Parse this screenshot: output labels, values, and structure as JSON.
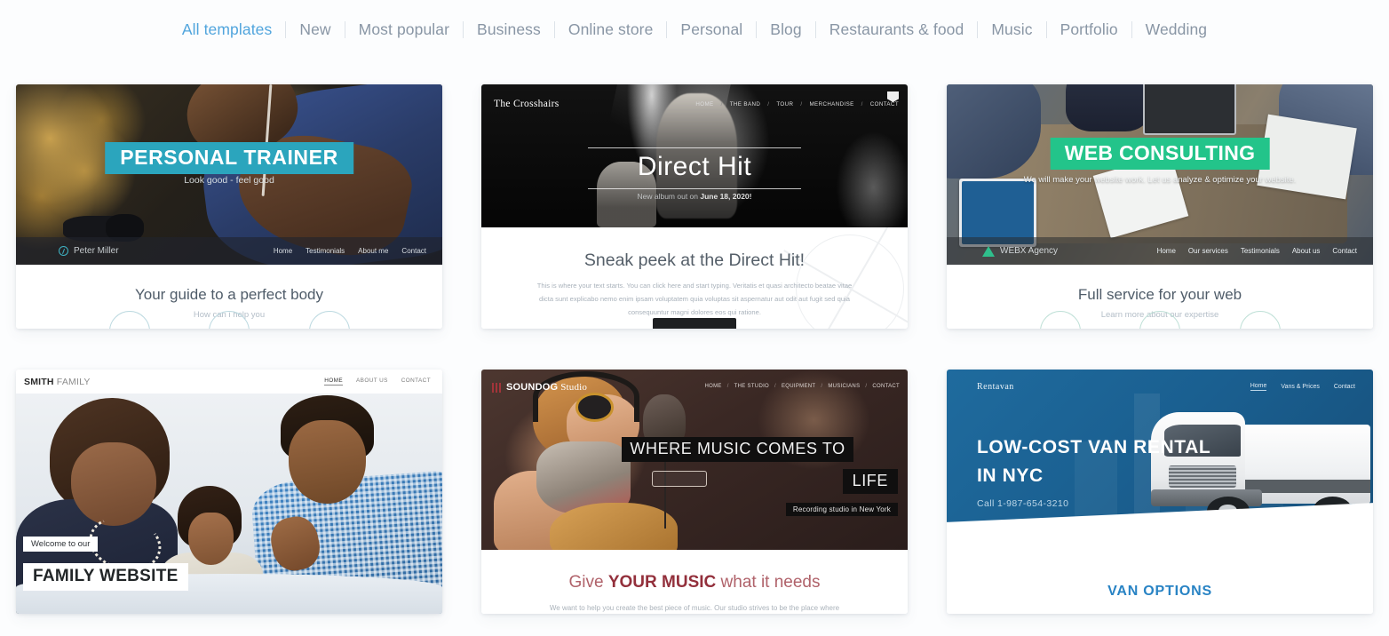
{
  "categories": [
    {
      "label": "All templates",
      "active": true
    },
    {
      "label": "New",
      "active": false
    },
    {
      "label": "Most popular",
      "active": false
    },
    {
      "label": "Business",
      "active": false
    },
    {
      "label": "Online store",
      "active": false
    },
    {
      "label": "Personal",
      "active": false
    },
    {
      "label": "Blog",
      "active": false
    },
    {
      "label": "Restaurants & food",
      "active": false
    },
    {
      "label": "Music",
      "active": false
    },
    {
      "label": "Portfolio",
      "active": false
    },
    {
      "label": "Wedding",
      "active": false
    }
  ],
  "colors": {
    "active_nav": "#51a5dd",
    "inactive_nav": "#8996a5",
    "page_bg": "#fcfdfe",
    "card_bg": "#ffffff",
    "trainer_accent": "#2ba5bd",
    "consulting_accent": "#23c48a",
    "music_accent": "#93303c",
    "van_accent": "#2883c4"
  },
  "templates": [
    {
      "id": "personal-trainer",
      "logo": "Peter Miller",
      "nav": [
        "Home",
        "Testimonials",
        "About me",
        "Contact"
      ],
      "hero_title": "PERSONAL TRAINER",
      "hero_sub": "Look good - feel good",
      "body_title": "Your guide to a perfect body",
      "body_sub": "How can i help you"
    },
    {
      "id": "the-crosshairs",
      "logo": "The Crosshairs",
      "nav": [
        "HOME",
        "THE BAND",
        "TOUR",
        "MERCHANDISE",
        "CONTACT"
      ],
      "hero_title": "Direct Hit",
      "album_prefix": "New album out on ",
      "album_date": "June 18, 2020!",
      "body_title": "Sneak peek at the Direct Hit!",
      "body_paragraph": "This is where your text starts. You can click here and start typing. Veritatis et quasi architecto beatae vitae dicta sunt explicabo nemo enim ipsam voluptatem quia voluptas sit aspernatur aut odit aut fugit sed quia consequuntur magni dolores eos qui ratione."
    },
    {
      "id": "web-consulting",
      "logo": "WEBX Agency",
      "nav": [
        "Home",
        "Our services",
        "Testimonials",
        "About us",
        "Contact"
      ],
      "hero_title": "WEB CONSULTING",
      "hero_sub": "We will make your website work. Let us analyze & optimize your website.",
      "body_title": "Full service for your web",
      "body_sub": "Learn more about our expertise"
    },
    {
      "id": "smith-family",
      "logo_bold": "SMITH",
      "logo_light": " FAMILY",
      "nav": [
        "HOME",
        "ABOUT US",
        "CONTACT"
      ],
      "overlay_small": "Welcome to our",
      "overlay_big": "FAMILY WEBSITE"
    },
    {
      "id": "soundog-studio",
      "logo_bold": "SOUNDOG",
      "logo_light": " Studio",
      "nav": [
        "HOME",
        "THE STUDIO",
        "EQUIPMENT",
        "MUSICIANS",
        "CONTACT"
      ],
      "band_line1": "WHERE MUSIC COMES TO",
      "band_line2": "LIFE",
      "band_line3": "Recording studio in New York",
      "body_title_pre": "Give ",
      "body_title_bold": "YOUR MUSIC",
      "body_title_post": " what it needs",
      "body_paragraph": "We want to help you create the best piece of music. Our studio strives to be the place where you feel creative and free."
    },
    {
      "id": "rentavan",
      "logo": "Rentavan",
      "nav": [
        "Home",
        "Vans & Prices",
        "Contact"
      ],
      "hero_title_line1": "LOW-COST VAN RENTAL",
      "hero_title_line2": "IN NYC",
      "phone": "Call 1-987-654-3210",
      "body_title": "VAN OPTIONS"
    }
  ]
}
